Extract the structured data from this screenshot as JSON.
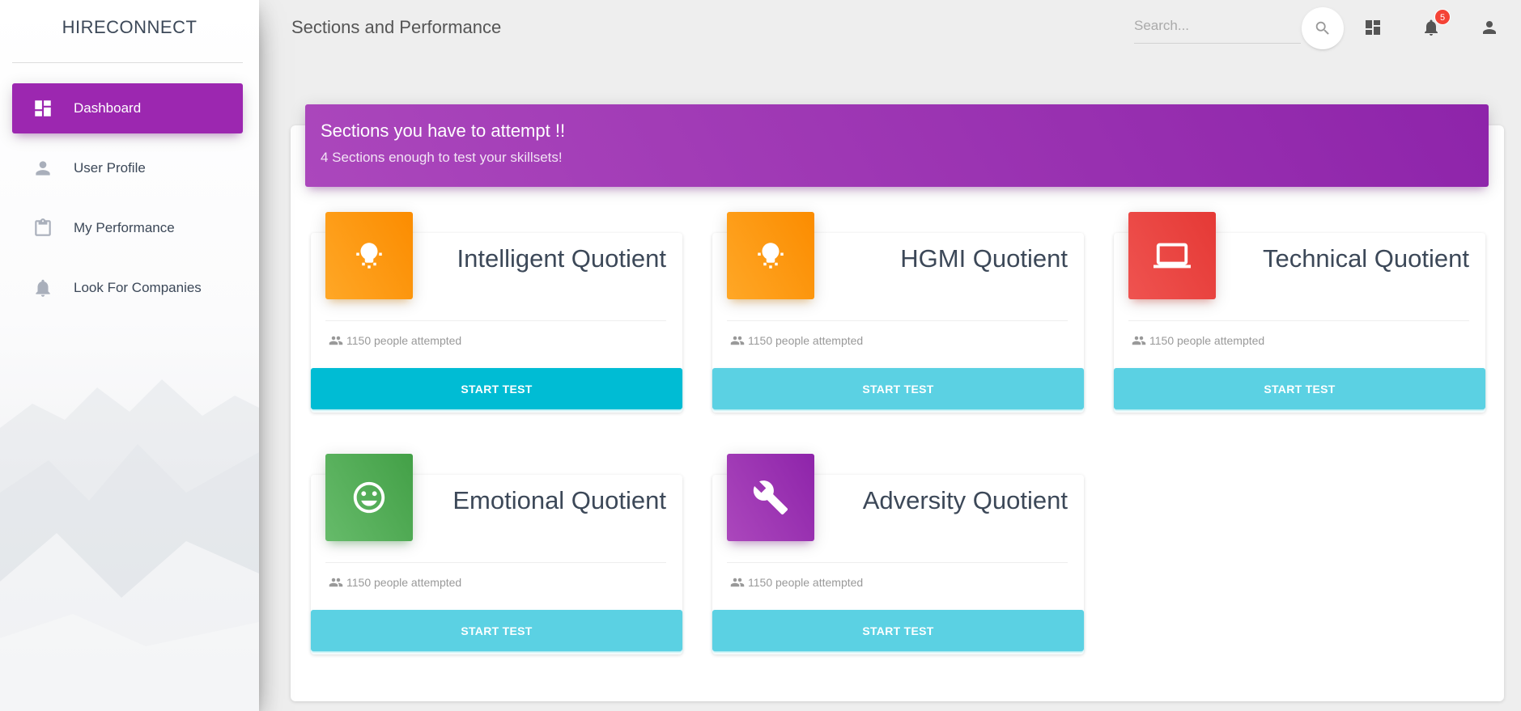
{
  "brand": "HIRECONNECT",
  "sidebar": {
    "items": [
      {
        "label": "Dashboard",
        "icon": "dashboard-icon",
        "active": true
      },
      {
        "label": "User Profile",
        "icon": "person-icon",
        "active": false
      },
      {
        "label": "My Performance",
        "icon": "clipboard-icon",
        "active": false
      },
      {
        "label": "Look For Companies",
        "icon": "bell-icon",
        "active": false
      }
    ]
  },
  "topbar": {
    "title": "Sections and Performance",
    "search_placeholder": "Search...",
    "notifications_count": "5"
  },
  "header": {
    "title": "Sections you have to attempt !!",
    "subtitle": "4 Sections enough to test your skillsets!"
  },
  "sections": [
    {
      "title": "Intelligent Quotient",
      "attempted": "1150 people attempted",
      "button": "START TEST",
      "icon": "lightbulb-icon",
      "color": "#fb8c00"
    },
    {
      "title": "HGMI Quotient",
      "attempted": "1150 people attempted",
      "button": "START TEST",
      "icon": "lightbulb-icon",
      "color": "#fb8c00"
    },
    {
      "title": "Technical Quotient",
      "attempted": "1150 people attempted",
      "button": "START TEST",
      "icon": "laptop-icon",
      "color": "#e53935"
    },
    {
      "title": "Emotional Quotient",
      "attempted": "1150 people attempted",
      "button": "START TEST",
      "icon": "smiley-icon",
      "color": "#43a047"
    },
    {
      "title": "Adversity Quotient",
      "attempted": "1150 people attempted",
      "button": "START TEST",
      "icon": "wrench-icon",
      "color": "#8e24aa"
    }
  ],
  "colors": {
    "primary": "#9c27b0",
    "button": "#5bd1e3",
    "button_active": "#00bcd4"
  }
}
